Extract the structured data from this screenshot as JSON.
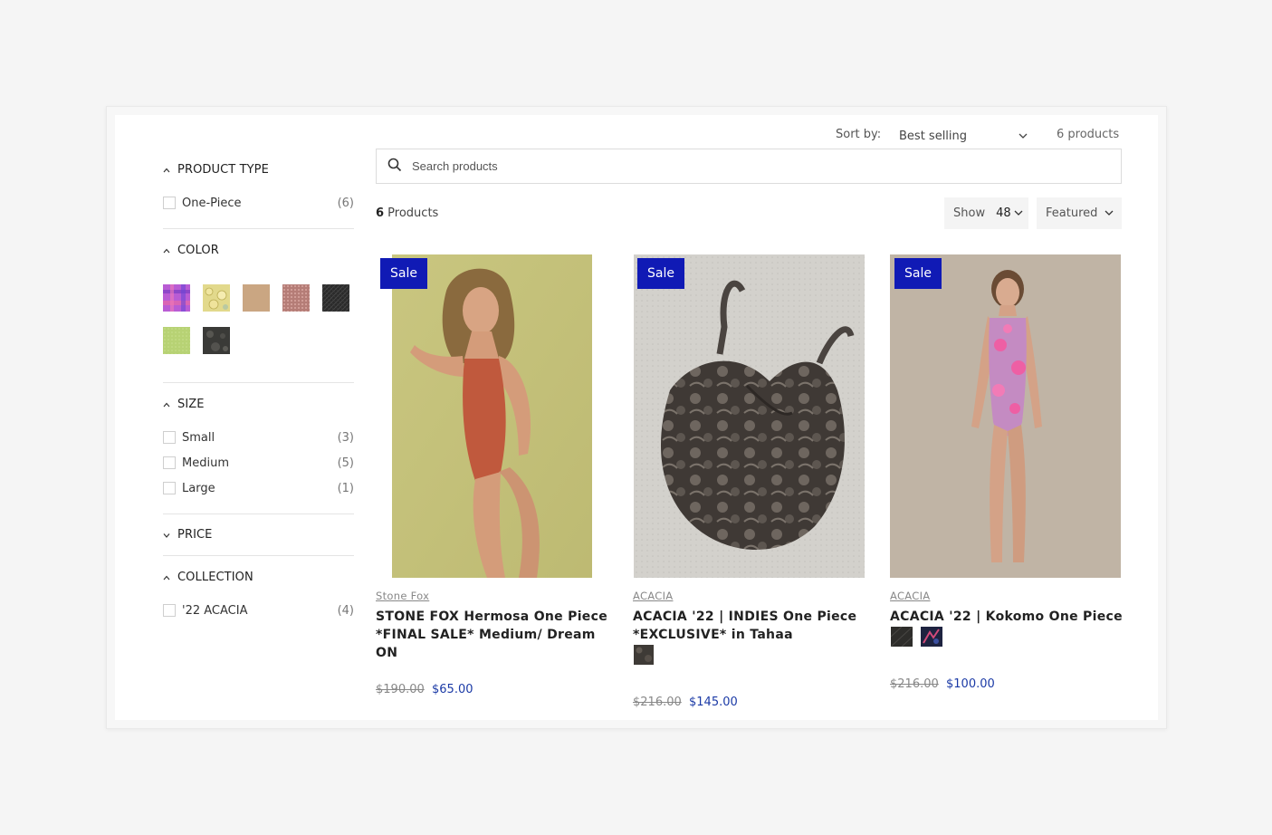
{
  "sidebar": {
    "product_type": {
      "heading": "PRODUCT TYPE",
      "items": [
        {
          "label": "One-Piece",
          "count": "(6)"
        }
      ]
    },
    "color": {
      "heading": "COLOR",
      "swatches": [
        {
          "name": "purple-plaid",
          "color": "#b45fd0"
        },
        {
          "name": "yellow-floral",
          "color": "#dcd58b"
        },
        {
          "name": "tan",
          "color": "#c9a581"
        },
        {
          "name": "rose-pattern",
          "color": "#b77c78"
        },
        {
          "name": "black-pattern",
          "color": "#2b2b2b"
        },
        {
          "name": "lime",
          "color": "#b9d474"
        },
        {
          "name": "charcoal-pattern",
          "color": "#3b3b38"
        }
      ]
    },
    "size": {
      "heading": "SIZE",
      "items": [
        {
          "label": "Small",
          "count": "(3)"
        },
        {
          "label": "Medium",
          "count": "(5)"
        },
        {
          "label": "Large",
          "count": "(1)"
        }
      ]
    },
    "price": {
      "heading": "PRICE"
    },
    "collection": {
      "heading": "COLLECTION",
      "items": [
        {
          "label": "'22 ACACIA",
          "count": "(4)"
        }
      ]
    }
  },
  "toolbar": {
    "sort_label": "Sort by:",
    "sort_value": "Best selling",
    "count_text": "6 products",
    "search_placeholder": "Search products",
    "products_num": "6",
    "products_word": " Products",
    "show_label": "Show",
    "show_value": "48",
    "featured_label": "Featured"
  },
  "products": [
    {
      "badge": "Sale",
      "vendor": "Stone Fox",
      "title_lines": [
        "STONE FOX Hermosa One Piece",
        "*FINAL SALE* Medium/ Dream",
        "ON"
      ],
      "old_price": "$190.00",
      "new_price": "$65.00"
    },
    {
      "badge": "Sale",
      "vendor": "ACACIA",
      "title_lines": [
        "ACACIA '22 | INDIES One Piece",
        "*EXCLUSIVE* in Tahaa"
      ],
      "old_price": "$216.00",
      "new_price": "$145.00"
    },
    {
      "badge": "Sale",
      "vendor": "ACACIA",
      "title_lines": [
        "ACACIA '22 | Kokomo One Piece"
      ],
      "old_price": "$216.00",
      "new_price": "$100.00"
    }
  ],
  "colors": {
    "accent": "#101ab5",
    "sale_price": "#1b3aa6"
  }
}
